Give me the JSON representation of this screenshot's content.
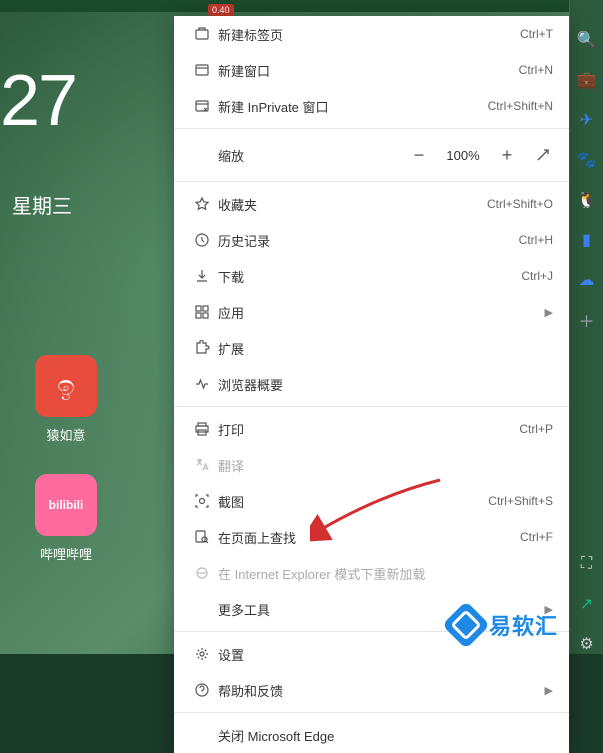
{
  "topbar": {
    "badge": "0.40"
  },
  "clock": {
    "time_fragment": "27",
    "weekday": "星期三"
  },
  "tiles": [
    {
      "id": "yuanruyi",
      "label": "猿如意",
      "color": "#e74c3c",
      "glyph": "ඉ"
    },
    {
      "id": "bilibili",
      "label": "哔哩哔哩",
      "color": "#ff6b9d",
      "glyph": "bilibili"
    }
  ],
  "menu": {
    "items": [
      {
        "icon": "tab-icon",
        "label": "新建标签页",
        "shortcut": "Ctrl+T"
      },
      {
        "icon": "window-icon",
        "label": "新建窗口",
        "shortcut": "Ctrl+N"
      },
      {
        "icon": "inprivate-icon",
        "label": "新建 InPrivate 窗口",
        "shortcut": "Ctrl+Shift+N"
      },
      {
        "sep": true
      },
      {
        "zoom": true,
        "label": "缩放",
        "minus": "−",
        "value": "100%",
        "plus": "+",
        "fullscreen": true
      },
      {
        "sep": true
      },
      {
        "icon": "star-icon",
        "label": "收藏夹",
        "shortcut": "Ctrl+Shift+O"
      },
      {
        "icon": "history-icon",
        "label": "历史记录",
        "shortcut": "Ctrl+H"
      },
      {
        "icon": "download-icon",
        "label": "下载",
        "shortcut": "Ctrl+J"
      },
      {
        "icon": "apps-icon",
        "label": "应用",
        "submenu": true
      },
      {
        "icon": "extension-icon",
        "label": "扩展"
      },
      {
        "icon": "pulse-icon",
        "label": "浏览器概要"
      },
      {
        "sep": true
      },
      {
        "icon": "print-icon",
        "label": "打印",
        "shortcut": "Ctrl+P"
      },
      {
        "icon": "translate-icon",
        "label": "翻译",
        "disabled": true
      },
      {
        "icon": "screenshot-icon",
        "label": "截图",
        "shortcut": "Ctrl+Shift+S"
      },
      {
        "icon": "find-icon",
        "label": "在页面上查找",
        "shortcut": "Ctrl+F"
      },
      {
        "icon": "ie-icon",
        "label": "在 Internet Explorer 模式下重新加载",
        "disabled": true
      },
      {
        "label": "更多工具",
        "submenu": true,
        "noicon": true
      },
      {
        "sep": true
      },
      {
        "icon": "gear-icon",
        "label": "设置"
      },
      {
        "icon": "help-icon",
        "label": "帮助和反馈",
        "submenu": true
      },
      {
        "sep": true
      },
      {
        "label": "关闭 Microsoft Edge",
        "noicon": true
      }
    ]
  },
  "brand": {
    "text": "易软汇"
  }
}
